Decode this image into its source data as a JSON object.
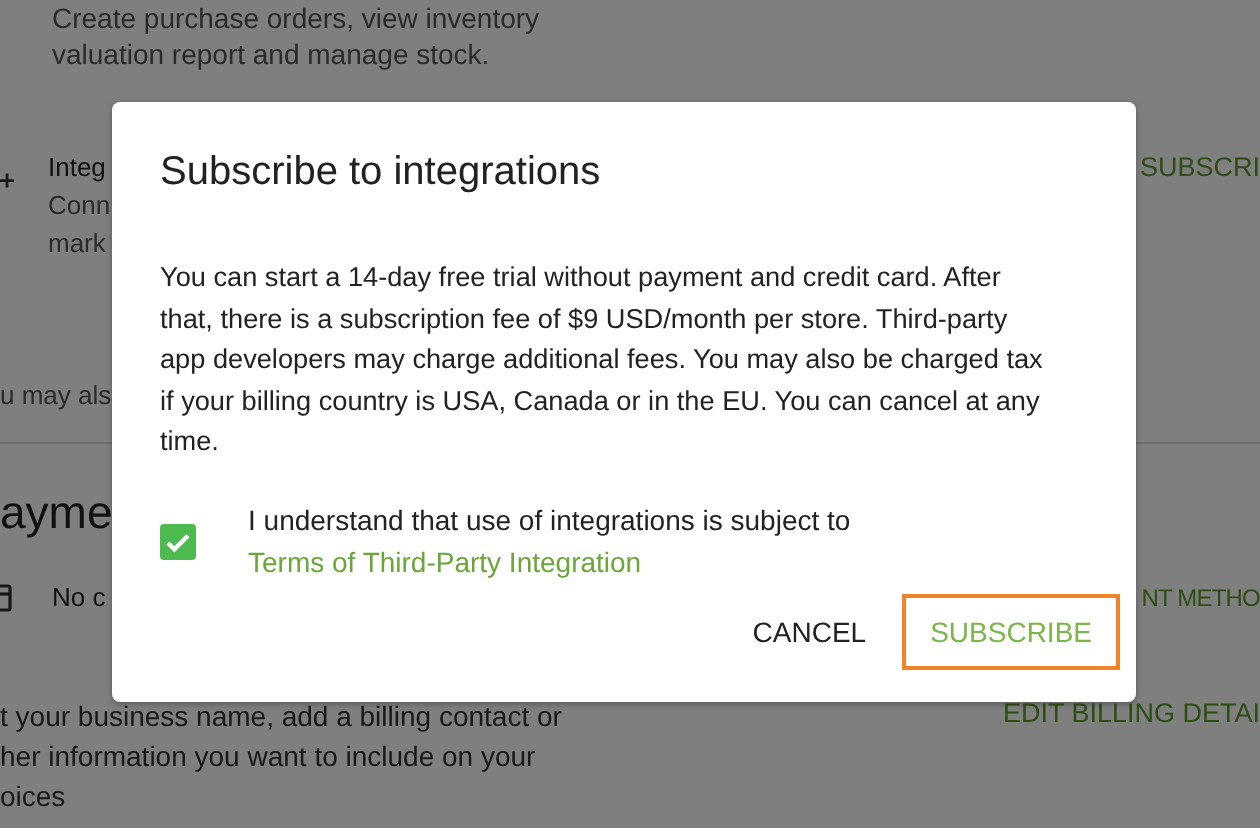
{
  "page": {
    "inventory_description": [
      "Create purchase orders, view inventory",
      "valuation report and manage stock."
    ],
    "integrations": {
      "title": "Integ",
      "description": [
        "Conn",
        "mark"
      ],
      "action": "SUBSCRI"
    },
    "note": "u may als",
    "payment_heading": "ayme",
    "payment_method": {
      "text": "No c",
      "action": "NT METHO"
    },
    "billing": {
      "description": [
        "t your business name, add a billing contact or",
        "her information you want to include on your",
        "oices"
      ],
      "action": "EDIT BILLING DETAI"
    }
  },
  "dialog": {
    "title": "Subscribe to integrations",
    "body": "You can start a 14-day free trial without payment and credit card. After that, there is a subscription fee of $9 USD/month per store. Third-party app developers may charge additional fees. You may also be charged tax if your billing country is USA, Canada or in the EU. You can cancel at any time.",
    "agreement": {
      "checked": true,
      "text": "I understand that use of integrations is subject to ",
      "link": "Terms of Third-Party Integration"
    },
    "buttons": [
      {
        "label": "CANCEL",
        "kind": "cancel",
        "highlighted": false
      },
      {
        "label": "SUBSCRIBE",
        "kind": "primary",
        "highlighted": true
      }
    ]
  }
}
